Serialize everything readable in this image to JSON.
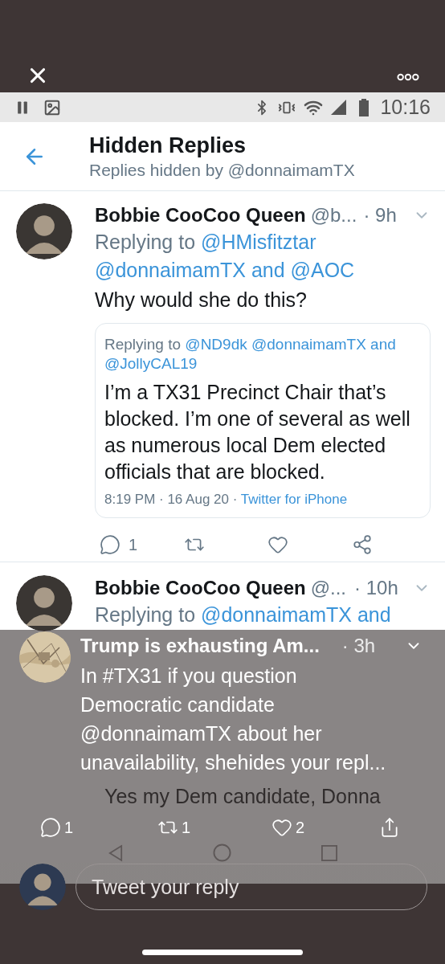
{
  "status_bar": {
    "time": "10:16"
  },
  "header": {
    "title": "Hidden Replies",
    "subtitle": "Replies hidden by @donnaimamTX"
  },
  "replies": [
    {
      "name": "Bobbie CooCoo Queen",
      "handle": "@b...",
      "time": "· 9h",
      "context": [
        {
          "text": "Replying to",
          "kind": "plain"
        },
        {
          "text": "@HMisfitztar",
          "kind": "mention"
        },
        {
          "text": "@donnaimamTX",
          "kind": "mention"
        },
        {
          "text": "and",
          "kind": "connector"
        },
        {
          "text": "@AOC",
          "kind": "mention"
        }
      ],
      "body": "Why would she do this?",
      "quote": {
        "context": [
          {
            "text": "Replying to",
            "kind": "plain"
          },
          {
            "text": "@ND9dk",
            "kind": "mention"
          },
          {
            "text": "@donnaimamTX",
            "kind": "mention"
          },
          {
            "text": "and",
            "kind": "connector"
          },
          {
            "text": "@JollyCAL19",
            "kind": "mention"
          }
        ],
        "text": "I’m a TX31 Precinct Chair that’s blocked. I’m one of several as well as numerous local Dem elected officials that are blocked.",
        "meta": [
          {
            "text": "8:19 PM · 16 Aug 20 ·",
            "kind": "plain"
          },
          {
            "text": "Twitter for iPhone",
            "kind": "link"
          }
        ]
      },
      "actions": [
        {
          "kind": "reply",
          "count": "1"
        },
        {
          "kind": "retweet"
        },
        {
          "kind": "like"
        },
        {
          "kind": "share"
        }
      ]
    },
    {
      "name": "Bobbie CooCoo Queen",
      "handle": "@...",
      "time": "· 10h",
      "context": [
        {
          "text": "Replying to",
          "kind": "plain"
        },
        {
          "text": "@donnaimamTX",
          "kind": "mention"
        },
        {
          "text": "and",
          "kind": "connector"
        }
      ],
      "quote": {
        "text": "Yes my Dem candidate, Donna"
      }
    }
  ],
  "overlay_tweet": {
    "title": "Trump is exhausting Am...",
    "time": "· 3h",
    "body_lines": [
      "In #TX31 if you question",
      "Democratic candidate",
      "@donnaimamTX about her",
      "unavailability, shehides your repl..."
    ],
    "actions": [
      {
        "kind": "reply",
        "count": "1"
      },
      {
        "kind": "retweet",
        "count": "1"
      },
      {
        "kind": "like",
        "count": "2"
      },
      {
        "kind": "share"
      }
    ]
  },
  "reply_box": {
    "placeholder": "Tweet your reply"
  }
}
